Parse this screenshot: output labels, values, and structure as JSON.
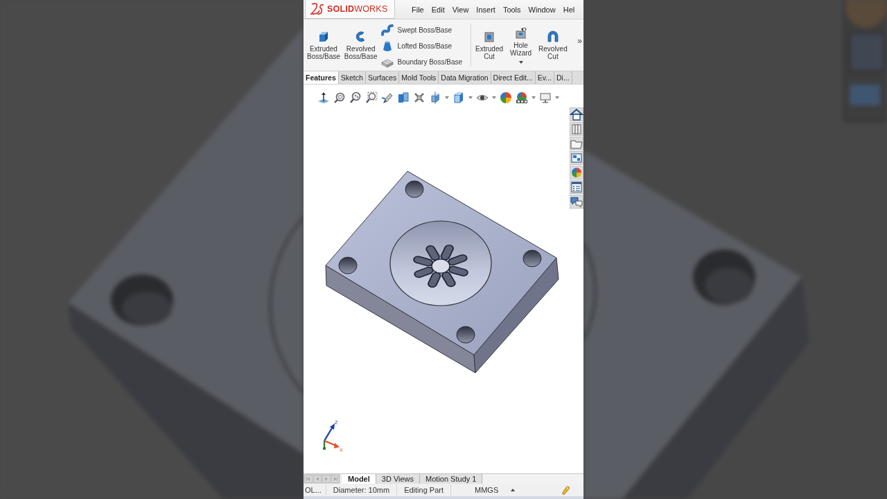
{
  "app": {
    "logo": "**SOLID**WORKS"
  },
  "menu": [
    {
      "label": "File"
    },
    {
      "label": "Edit"
    },
    {
      "label": "View"
    },
    {
      "label": "Insert"
    },
    {
      "label": "Tools"
    },
    {
      "label": "Window"
    },
    {
      "label": "Hel"
    }
  ],
  "command_groups": [
    {
      "commands": [
        {
          "kind": "large",
          "label": "Extruded Boss/Base",
          "dropdown": false
        },
        {
          "kind": "large",
          "label": "Revolved Boss/Base",
          "dropdown": false
        },
        {
          "kind": "small",
          "label": "Swept Boss/Base",
          "dropdown": false
        },
        {
          "kind": "small",
          "label": "Lofted Boss/Base",
          "dropdown": false
        },
        {
          "kind": "small",
          "label": "Boundary Boss/Base",
          "dropdown": false
        }
      ]
    },
    {
      "commands": [
        {
          "kind": "large",
          "label": "Extruded Cut",
          "dropdown": false
        },
        {
          "kind": "large",
          "label": "Hole Wizard",
          "dropdown": true
        },
        {
          "kind": "large",
          "label": "Revolved Cut",
          "dropdown": false
        }
      ]
    }
  ],
  "overflow": "»",
  "tabs": [
    {
      "label": "Features",
      "selected": true
    },
    {
      "label": "Sketch",
      "selected": false
    },
    {
      "label": "Surfaces",
      "selected": false
    },
    {
      "label": "Mold Tools",
      "selected": false
    },
    {
      "label": "Data Migration",
      "selected": false
    },
    {
      "label": "Direct Edit...",
      "selected": false
    },
    {
      "label": "Ev...",
      "selected": false
    },
    {
      "label": "Di...",
      "selected": false
    }
  ],
  "triad": {
    "z_label": "Z",
    "x_label": "X"
  },
  "bottom_tabs": [
    {
      "label": "Model",
      "selected": true
    },
    {
      "label": "3D Views",
      "selected": false
    },
    {
      "label": "Motion Study 1",
      "selected": false
    }
  ],
  "status_bar": {
    "segments": [
      "OL...",
      "Diameter: 10mm",
      "Editing Part"
    ],
    "units": "MMGS"
  }
}
